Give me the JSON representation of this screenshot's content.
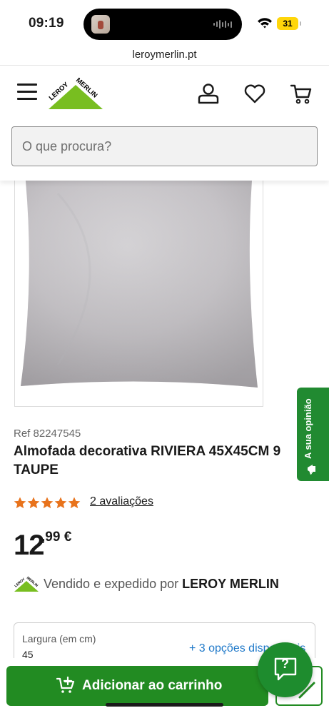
{
  "status_bar": {
    "time": "09:19",
    "battery": "31"
  },
  "browser": {
    "url": "leroymerlin.pt"
  },
  "header": {
    "brand": "LEROY MERLIN",
    "search_placeholder": "O que procura?"
  },
  "feedback_tab": {
    "label": "A sua opinião"
  },
  "product": {
    "ref": "Ref 82247545",
    "title_line1": "Almofada decorativa RIVIERA 45X45CM 9",
    "title_line2": "TAUPE",
    "rating_stars": 5,
    "reviews_link": "2 avaliações",
    "price_int": "12",
    "price_dec": ",99 €",
    "seller_prefix": "Vendido e expedido por ",
    "seller_name": "LEROY MERLIN"
  },
  "option": {
    "label": "Largura (em cm)",
    "value": "45",
    "more_link": "+ 3 opções disponíveis"
  },
  "actions": {
    "add_to_cart": "Adicionar ao carrinho",
    "chat_label": "?"
  },
  "colors": {
    "brand_green": "#228b22",
    "star_orange": "#e8731c",
    "link_blue": "#1f79c9"
  }
}
